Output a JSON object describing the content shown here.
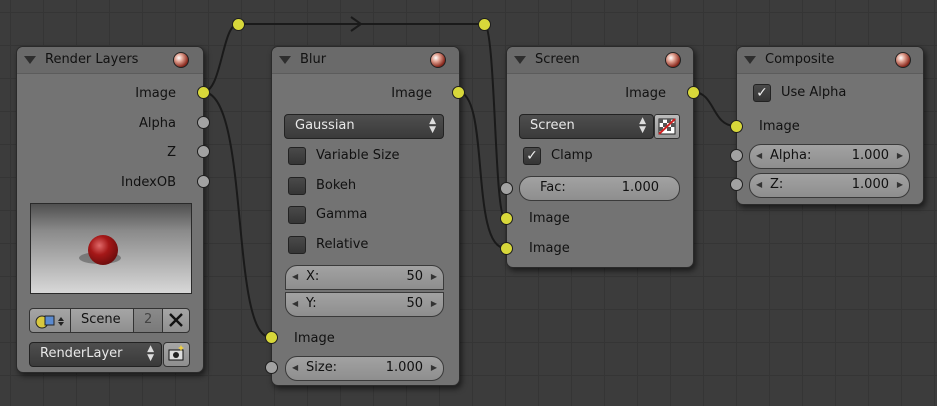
{
  "render_layers": {
    "title": "Render Layers",
    "outputs": [
      "Image",
      "Alpha",
      "Z",
      "IndexOB"
    ],
    "scene_label": "Scene",
    "scene_count": "2",
    "layer_label": "RenderLayer"
  },
  "blur": {
    "title": "Blur",
    "output": "Image",
    "filter": "Gaussian",
    "checkboxes": [
      "Variable Size",
      "Bokeh",
      "Gamma",
      "Relative"
    ],
    "x_label": "X:",
    "x_value": "50",
    "y_label": "Y:",
    "y_value": "50",
    "input_image": "Image",
    "size_label": "Size:",
    "size_value": "1.000"
  },
  "screen": {
    "title": "Screen",
    "output": "Image",
    "blend": "Screen",
    "clamp_label": "Clamp",
    "fac_label": "Fac:",
    "fac_value": "1.000",
    "input1": "Image",
    "input2": "Image"
  },
  "composite": {
    "title": "Composite",
    "use_alpha_label": "Use Alpha",
    "input_image": "Image",
    "alpha_label": "Alpha:",
    "alpha_value": "1.000",
    "z_label": "Z:",
    "z_value": "1.000"
  },
  "colors": {
    "background": "#3c3c3c",
    "node_body": "#737373",
    "socket_image": "#d8d83a",
    "socket_value": "#a2a2a2",
    "wire": "#1a1a1a"
  }
}
